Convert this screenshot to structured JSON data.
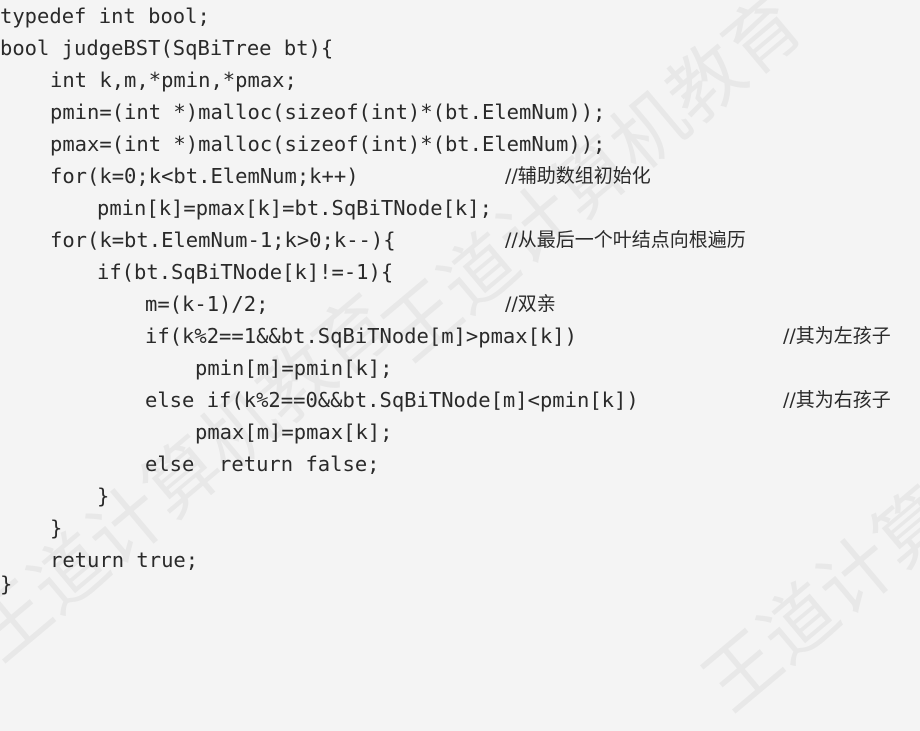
{
  "watermark": "王道计算机教育",
  "code": {
    "lines": [
      {
        "text": "typedef int bool;",
        "comment": ""
      },
      {
        "text": "bool judgeBST(SqBiTree bt){",
        "comment": ""
      },
      {
        "text": "int k,m,*pmin,*pmax;",
        "comment": ""
      },
      {
        "text": "pmin=(int *)malloc(sizeof(int)*(bt.ElemNum));",
        "comment": ""
      },
      {
        "text": "pmax=(int *)malloc(sizeof(int)*(bt.ElemNum));",
        "comment": ""
      },
      {
        "text": "for(k=0;k<bt.ElemNum;k++)",
        "comment": "//辅助数组初始化"
      },
      {
        "text": "pmin[k]=pmax[k]=bt.SqBiTNode[k];",
        "comment": ""
      },
      {
        "text": "for(k=bt.ElemNum-1;k>0;k--){",
        "comment": "//从最后一个叶结点向根遍历"
      },
      {
        "text": "if(bt.SqBiTNode[k]!=-1){",
        "comment": ""
      },
      {
        "text": "m=(k-1)/2;",
        "comment": "//双亲"
      },
      {
        "text": "if(k%2==1&&bt.SqBiTNode[m]>pmax[k])",
        "comment": "//其为左孩子"
      },
      {
        "text": "pmin[m]=pmin[k];",
        "comment": ""
      },
      {
        "text": "else if(k%2==0&&bt.SqBiTNode[m]<pmin[k])",
        "comment": "//其为右孩子"
      },
      {
        "text": "pmax[m]=pmax[k];",
        "comment": ""
      },
      {
        "text": "else  return false;",
        "comment": ""
      },
      {
        "text": "}",
        "comment": ""
      },
      {
        "text": "}",
        "comment": ""
      },
      {
        "text": "return true;",
        "comment": ""
      },
      {
        "text": "}",
        "comment": ""
      }
    ]
  }
}
